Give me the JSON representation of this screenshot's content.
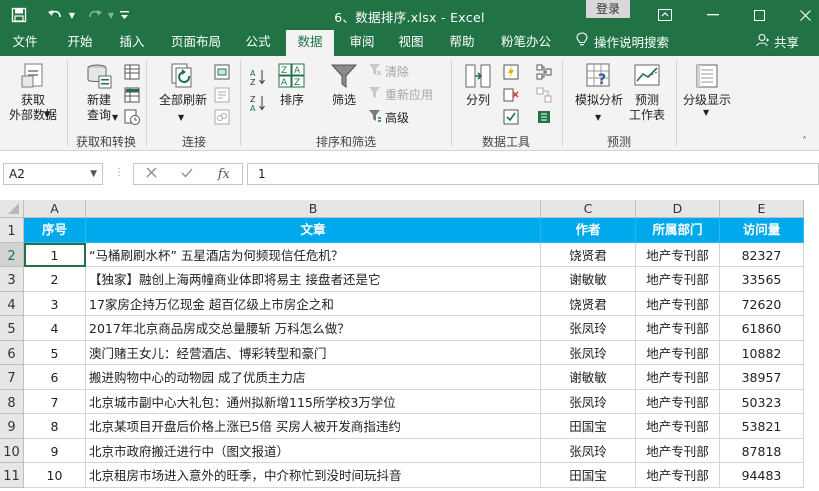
{
  "window": {
    "title": "6、数据排序.xlsx  -  Excel",
    "login_label": "登录"
  },
  "colors": {
    "brand": "#217346",
    "header_fill": "#00a8ec",
    "header_text": "#ffffff"
  },
  "icons": {
    "save": "save-icon",
    "undo": "undo-icon",
    "redo": "redo-icon",
    "customize": "customize-toolbar-icon",
    "minimize": "minimize-icon",
    "restore": "ribbon-display-icon",
    "tellme": "lightbulb-icon",
    "share": "person-icon"
  },
  "menu": {
    "tabs": [
      "文件",
      "开始",
      "插入",
      "页面布局",
      "公式",
      "数据",
      "审阅",
      "视图",
      "帮助",
      "粉笔办公"
    ],
    "active": "数据",
    "tellme": "操作说明搜索",
    "share": "共享"
  },
  "ribbon": {
    "get_external": [
      "获取",
      "外部数据"
    ],
    "new_query": [
      "新建",
      "查询"
    ],
    "refresh_all": "全部刷新",
    "sort": "排序",
    "filter": "筛选",
    "clear": "清除",
    "reapply": "重新应用",
    "advanced": "高级",
    "split": "分列",
    "whatif": "模拟分析",
    "forecast_sheet": [
      "预测",
      "工作表"
    ],
    "outline": "分级显示",
    "groups": {
      "get_transform": "获取和转换",
      "connections": "连接",
      "sort_filter": "排序和筛选",
      "data_tools": "数据工具",
      "forecast": "预测"
    }
  },
  "formula_bar": {
    "name_box": "A2",
    "fx": "fx",
    "content": "1"
  },
  "sheet": {
    "columns": [
      "A",
      "B",
      "C",
      "D",
      "E"
    ],
    "row_numbers": [
      "1",
      "2",
      "3",
      "4",
      "5",
      "6",
      "7",
      "8",
      "9",
      "10",
      "11"
    ],
    "header": [
      "序号",
      "文章",
      "作者",
      "所属部门",
      "访问量"
    ],
    "rows": [
      [
        "1",
        "“马桶刷刷水杯” 五星酒店为何频现信任危机？",
        "饶贤君",
        "地产专刊部",
        "82327"
      ],
      [
        "2",
        "【独家】融创上海两幢商业体即将易主 接盘者还是它",
        "谢敏敏",
        "地产专刊部",
        "33565"
      ],
      [
        "3",
        "17家房企持万亿现金 超百亿级上市房企之和",
        "饶贤君",
        "地产专刊部",
        "72620"
      ],
      [
        "4",
        "2017年北京商品房成交总量腰斩 万科怎么做？",
        "张凤玲",
        "地产专刊部",
        "61860"
      ],
      [
        "5",
        "澳门赌王女儿：经营酒店、博彩转型和豪门",
        "张凤玲",
        "地产专刊部",
        "10882"
      ],
      [
        "6",
        "搬进购物中心的动物园 成了优质主力店",
        "谢敏敏",
        "地产专刊部",
        "38957"
      ],
      [
        "7",
        "北京城市副中心大礼包：通州拟新增115所学校3万学位",
        "张凤玲",
        "地产专刊部",
        "50323"
      ],
      [
        "8",
        "北京某项目开盘后价格上涨已5倍 买房人被开发商指违约",
        "田国宝",
        "地产专刊部",
        "53821"
      ],
      [
        "9",
        "北京市政府搬迁进行中（图文报道）",
        "张凤玲",
        "地产专刊部",
        "87818"
      ],
      [
        "10",
        "北京租房市场进入意外的旺季，中介称忙到没时间玩抖音",
        "田国宝",
        "地产专刊部",
        "94483"
      ]
    ]
  }
}
